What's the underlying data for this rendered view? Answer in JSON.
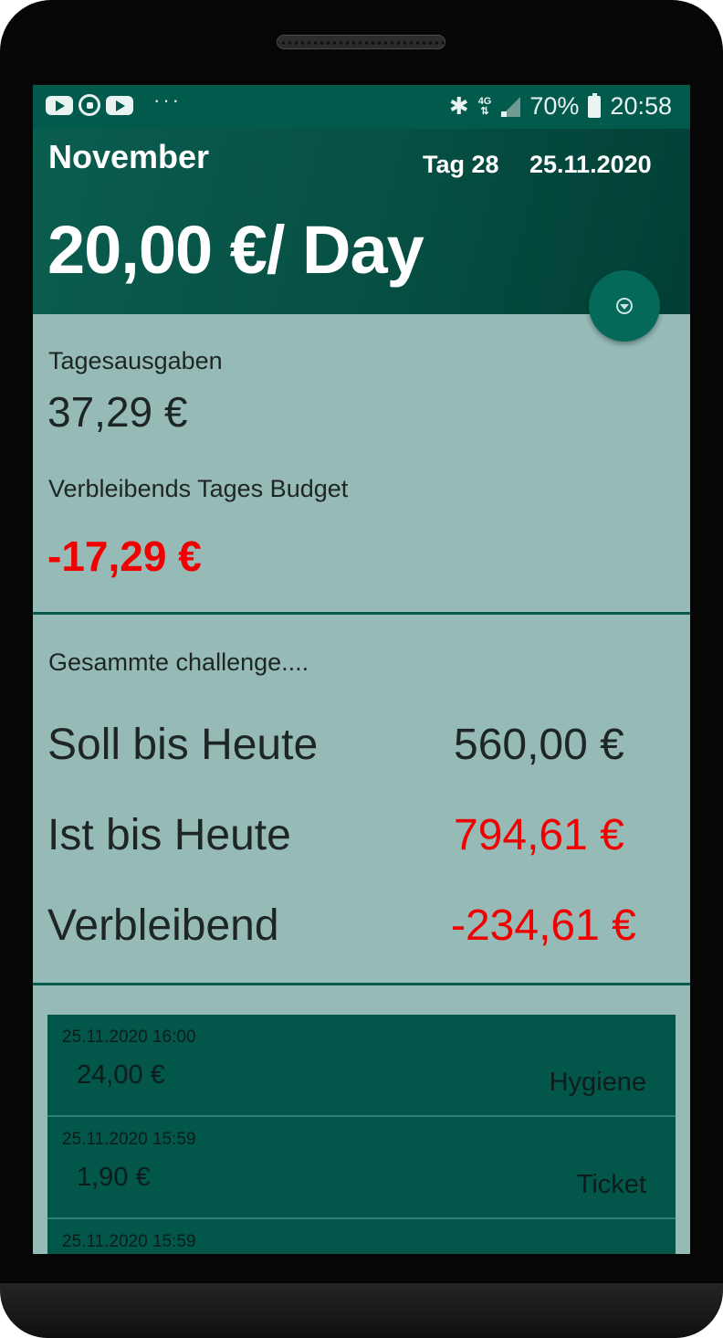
{
  "status_bar": {
    "time": "20:58",
    "battery": "70%",
    "network": "4G",
    "notification_icons": [
      "youtube-icon",
      "whatsapp-icon",
      "youtube-icon"
    ],
    "overflow": "···"
  },
  "header": {
    "month": "November",
    "day_label": "Tag 28",
    "date": "25.11.2020",
    "per_day": "20,00 €/ Day"
  },
  "daily": {
    "spending_label": "Tagesausgaben",
    "spending_value": "37,29 €",
    "remaining_label": "Verbleibends Tages Budget",
    "remaining_value": "-17,29 €"
  },
  "challenge": {
    "title": "Gesammte challenge....",
    "rows": [
      {
        "label": "Soll bis Heute",
        "value": "560,00 €"
      },
      {
        "label": "Ist bis Heute",
        "value": "794,61 €"
      },
      {
        "label": "Verbleibend",
        "value": "-234,61 €"
      }
    ]
  },
  "transactions": [
    {
      "datetime": "25.11.2020  16:00",
      "amount": "24,00 €",
      "category": "Hygiene"
    },
    {
      "datetime": "25.11.2020  15:59",
      "amount": "1,90 €",
      "category": "Ticket"
    },
    {
      "datetime": "25.11.2020  15:59",
      "amount": "",
      "category": ""
    }
  ],
  "colors": {
    "primary": "#015a4b",
    "background": "#96bbb7",
    "negative": "#f00000"
  }
}
